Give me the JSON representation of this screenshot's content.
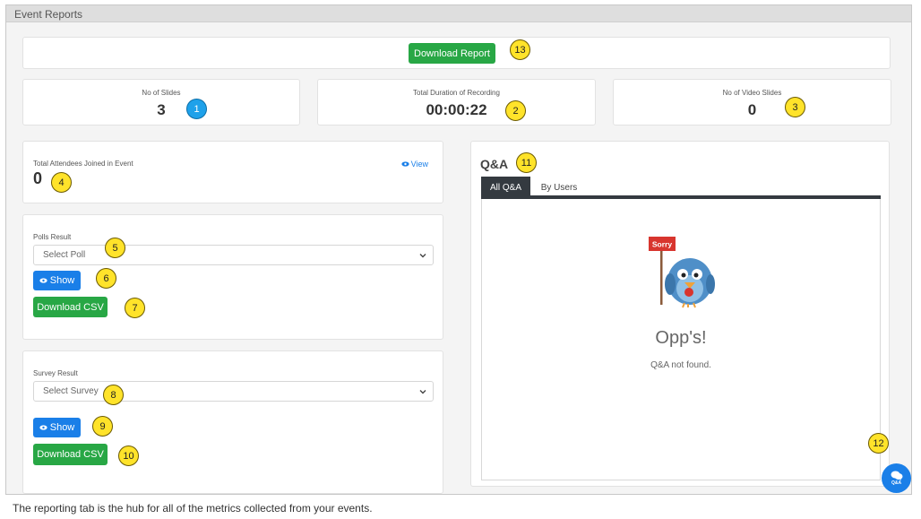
{
  "window": {
    "title": "Event Reports"
  },
  "toolbar": {
    "download_report_label": "Download Report"
  },
  "stats": [
    {
      "label": "No of Slides",
      "value": "3"
    },
    {
      "label": "Total Duration of Recording",
      "value": "00:00:22"
    },
    {
      "label": "No of Video Slides",
      "value": "0"
    }
  ],
  "attendees": {
    "label": "Total Attendees Joined in Event",
    "value": "0",
    "view_label": "View"
  },
  "polls": {
    "label": "Polls Result",
    "select_value": "Select Poll",
    "show_label": "Show",
    "csv_label": "Download CSV"
  },
  "survey": {
    "label": "Survey Result",
    "select_value": "Select Survey",
    "show_label": "Show",
    "csv_label": "Download CSV"
  },
  "qa": {
    "title": "Q&A",
    "tabs": [
      {
        "label": "All Q&A"
      },
      {
        "label": "By Users"
      }
    ],
    "sign_text": "Sorry",
    "empty_title": "Opp's!",
    "empty_message": "Q&A not found.",
    "chat_label": "Q&A"
  },
  "callouts": [
    "1",
    "2",
    "3",
    "4",
    "5",
    "6",
    "7",
    "8",
    "9",
    "10",
    "11",
    "12",
    "13"
  ],
  "caption": "The reporting tab is the hub for all of the metrics collected from your events.",
  "colors": {
    "green": "#28a745",
    "blue": "#1a7fe8",
    "badge_yellow": "#ffe32a",
    "badge_blue": "#1ea1ea",
    "tab_dark": "#343a40"
  }
}
